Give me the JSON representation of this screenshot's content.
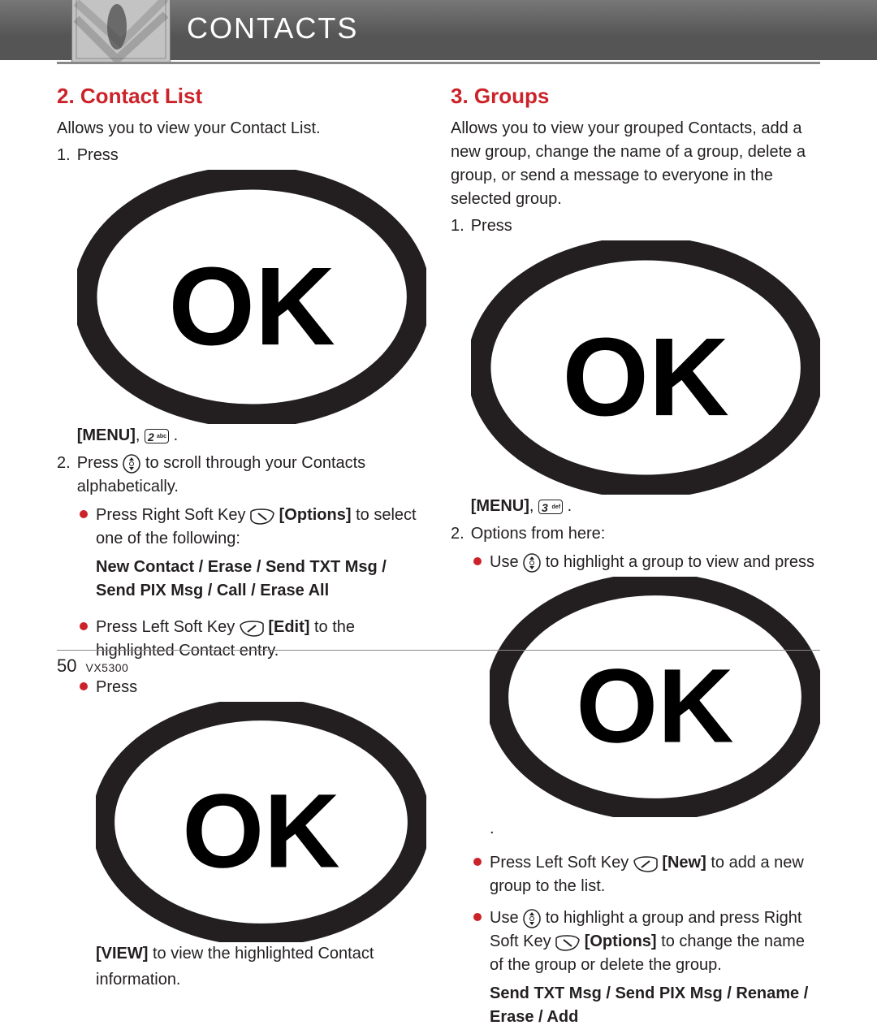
{
  "header": {
    "title": "CONTACTS"
  },
  "footer": {
    "page": "50",
    "model": "VX5300"
  },
  "left": {
    "heading": "2. Contact List",
    "intro": "Allows you to view your Contact List.",
    "step1_a": "Press ",
    "menu_label": "[MENU]",
    "comma": ", ",
    "period": " .",
    "key2_big": "2",
    "key2_small": "abc",
    "step2_a": "Press ",
    "step2_b": " to scroll through your Contacts alphabetically.",
    "b1_a": "Press Right Soft Key ",
    "options_label": "[Options]",
    "b1_b": " to select one of the following:",
    "b1_bold": "New Contact / Erase / Send TXT Msg / Send PIX Msg / Call / Erase All",
    "b2_a": "Press Left Soft Key ",
    "edit_label": "[Edit]",
    "b2_b": " to the highlighted Contact entry.",
    "b3_a": "Press ",
    "view_label": "[VIEW]",
    "b3_b": " to view the highlighted Contact information."
  },
  "right": {
    "heading": "3. Groups",
    "intro": "Allows you to view your grouped Contacts, add a new group, change the name of a group, delete a group, or send a message to everyone in the selected group.",
    "step1_a": "Press ",
    "menu_label": "[MENU]",
    "comma": ", ",
    "period": " .",
    "key3_big": "3",
    "key3_small": "def",
    "step2": "Options from here:",
    "b1_a": "Use ",
    "b1_b": " to highlight a group to view and press ",
    "b1_c": " .",
    "b2_a": "Press Left Soft Key ",
    "new_label": "[New]",
    "b2_b": " to add a new group to the list.",
    "b3_a": "Use ",
    "b3_b": " to highlight a group and press Right Soft Key ",
    "options_label": "[Options]",
    "b3_c": " to change the name of the group or delete the group.",
    "b3_bold": "Send TXT Msg / Send PIX Msg / Rename / Erase / Add"
  }
}
